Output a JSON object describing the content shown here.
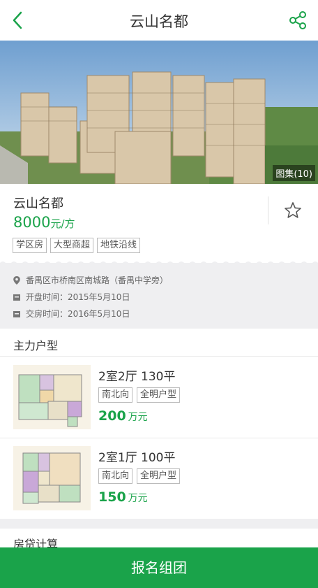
{
  "nav": {
    "title": "云山名都"
  },
  "hero": {
    "gallery_label": "图集(10)"
  },
  "project": {
    "name": "云山名都",
    "price_value": "8000",
    "price_unit": "元/方",
    "tags": [
      "学区房",
      "大型商超",
      "地铁沿线"
    ]
  },
  "details": {
    "address": "番禺区市桥南区南城路（番禺中学旁）",
    "open_date": "开盘时间：2015年5月10日",
    "delivery_date": "交房时间：2016年5月10日"
  },
  "main_units": {
    "title": "主力户型",
    "items": [
      {
        "title": "2室2厅 130平",
        "tags": [
          "南北向",
          "全明户型"
        ],
        "price": "200",
        "price_unit": "万元"
      },
      {
        "title": "2室1厅 100平",
        "tags": [
          "南北向",
          "全明户型"
        ],
        "price": "150",
        "price_unit": "万元"
      }
    ]
  },
  "loan": {
    "title": "房贷计算"
  },
  "cta": {
    "label": "报名组团"
  },
  "colors": {
    "accent": "#1aa34a",
    "background_gray": "#efeff1"
  }
}
